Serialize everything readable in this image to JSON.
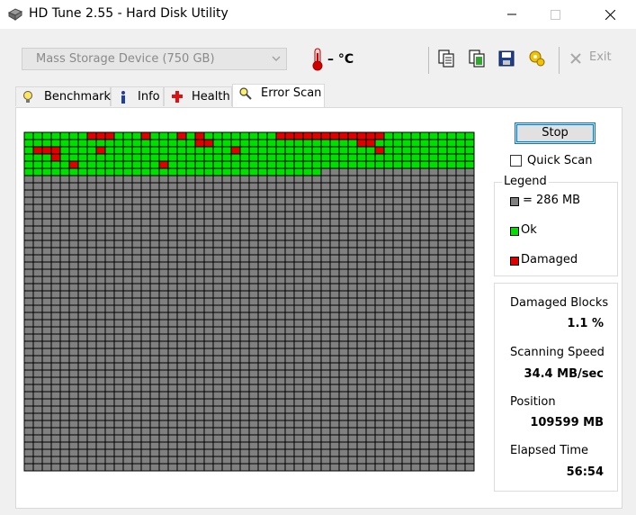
{
  "window": {
    "title": "HD Tune 2.55 - Hard Disk Utility"
  },
  "toolbar": {
    "drive_selected": "Mass Storage Device (750 GB)",
    "temperature": "– °C",
    "exit_label": "Exit"
  },
  "tabs": [
    {
      "label": "Benchmark",
      "icon": "bulb-icon"
    },
    {
      "label": "Info",
      "icon": "info-icon"
    },
    {
      "label": "Health",
      "icon": "health-cross-icon"
    },
    {
      "label": "Error Scan",
      "icon": "magnifier-icon",
      "active": true
    }
  ],
  "scan": {
    "stop_label": "Stop",
    "quick_scan_label": "Quick Scan",
    "quick_scan_checked": false,
    "grid": {
      "columns": 50,
      "rows": 47,
      "ok_full_rows": 5,
      "ok_partial_last_row_count": 33,
      "damaged_cells": [
        [
          0,
          7
        ],
        [
          0,
          8
        ],
        [
          0,
          9
        ],
        [
          0,
          13
        ],
        [
          0,
          17
        ],
        [
          0,
          19
        ],
        [
          0,
          28
        ],
        [
          0,
          29
        ],
        [
          0,
          30
        ],
        [
          0,
          31
        ],
        [
          0,
          32
        ],
        [
          0,
          33
        ],
        [
          0,
          34
        ],
        [
          0,
          35
        ],
        [
          0,
          36
        ],
        [
          0,
          37
        ],
        [
          0,
          38
        ],
        [
          0,
          39
        ],
        [
          1,
          19
        ],
        [
          1,
          20
        ],
        [
          1,
          37
        ],
        [
          1,
          38
        ],
        [
          2,
          1
        ],
        [
          2,
          2
        ],
        [
          2,
          3
        ],
        [
          2,
          8
        ],
        [
          2,
          23
        ],
        [
          2,
          39
        ],
        [
          3,
          3
        ],
        [
          4,
          5
        ],
        [
          4,
          15
        ]
      ]
    }
  },
  "legend": {
    "title": "Legend",
    "items": [
      {
        "label": "= 286 MB",
        "color": "#808080"
      },
      {
        "label": "Ok",
        "color": "#00e000"
      },
      {
        "label": "Damaged",
        "color": "#e00000"
      }
    ]
  },
  "stats": {
    "damaged_blocks_label": "Damaged Blocks",
    "damaged_blocks_value": "1.1 %",
    "speed_label": "Scanning Speed",
    "speed_value": "34.4 MB/sec",
    "position_label": "Position",
    "position_value": "109599 MB",
    "elapsed_label": "Elapsed Time",
    "elapsed_value": "56:54"
  }
}
